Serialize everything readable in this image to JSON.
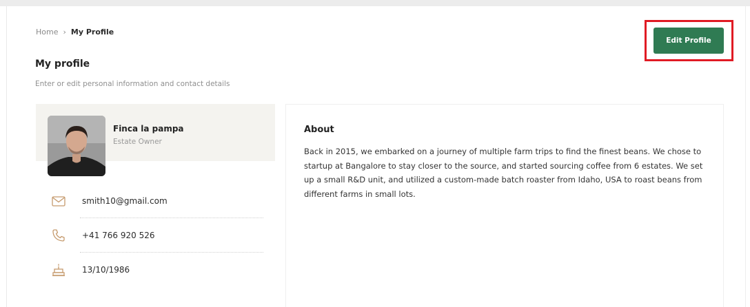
{
  "breadcrumb": {
    "home": "Home",
    "separator": "›",
    "current": "My Profile"
  },
  "header": {
    "title": "My profile",
    "subtitle": "Enter or edit personal information and contact details",
    "edit_button": "Edit Profile"
  },
  "profile": {
    "name": "Finca la pampa",
    "role": "Estate Owner",
    "email": "smith10@gmail.com",
    "phone": "+41  766 920 526",
    "birthdate": "13/10/1986"
  },
  "about": {
    "title": "About",
    "text": "Back in 2015, we embarked on a journey of multiple farm trips to find the finest beans. We chose to startup at Bangalore to stay closer to the source, and started sourcing coffee from 6 estates. We set up a small R&D unit, and utilized a custom-made batch roaster from Idaho, USA to roast beans from different farms in small lots."
  },
  "colors": {
    "accent": "#2f7b53",
    "highlight": "#e01b24",
    "icon": "#c59a6d"
  },
  "icons": {
    "email": "mail-icon",
    "phone": "phone-icon",
    "birthdate": "cake-icon"
  }
}
